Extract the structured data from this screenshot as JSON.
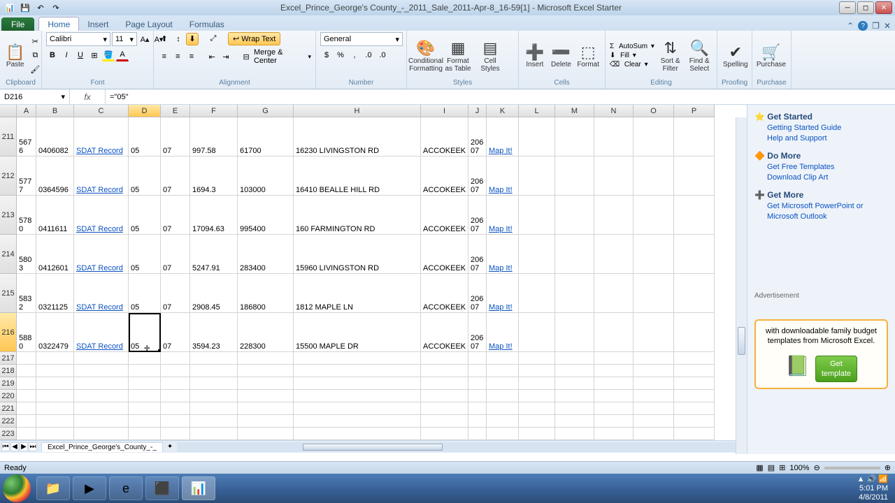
{
  "title": "Excel_Prince_George's County_-_2011_Sale_2011-Apr-8_16-59[1] - Microsoft Excel Starter",
  "ribbon": {
    "file": "File",
    "tabs": [
      "Home",
      "Insert",
      "Page Layout",
      "Formulas"
    ],
    "groups": {
      "clipboard": "Clipboard",
      "font": "Font",
      "alignment": "Alignment",
      "number": "Number",
      "styles": "Styles",
      "cells": "Cells",
      "editing": "Editing",
      "proofing": "Proofing",
      "purchase": "Purchase"
    },
    "paste": "Paste",
    "font_name": "Calibri",
    "font_size": "11",
    "wrap_text": "Wrap Text",
    "merge": "Merge & Center",
    "number_format": "General",
    "cond_format": "Conditional\nFormatting",
    "format_table": "Format\nas Table",
    "cell_styles": "Cell\nStyles",
    "insert": "Insert",
    "delete": "Delete",
    "format": "Format",
    "autosum": "AutoSum",
    "fill": "Fill",
    "clear": "Clear",
    "sort": "Sort &\nFilter",
    "find": "Find &\nSelect",
    "spelling": "Spelling",
    "purchase_btn": "Purchase"
  },
  "namebox": "D216",
  "formula": "=\"05\"",
  "columns": [
    "A",
    "B",
    "C",
    "D",
    "E",
    "F",
    "G",
    "H",
    "I",
    "J",
    "K",
    "L",
    "M",
    "N",
    "O",
    "P"
  ],
  "data_rows": [
    {
      "rn": "211",
      "a": "5676",
      "b": "0406082",
      "c": "SDAT Record",
      "d": "05",
      "e": "07",
      "f": "997.58",
      "g": "61700",
      "h": "16230 LIVINGSTON RD",
      "i": "ACCOKEEK",
      "j": "20607",
      "k": "Map It!"
    },
    {
      "rn": "212",
      "a": "5777",
      "b": "0364596",
      "c": "SDAT Record",
      "d": "05",
      "e": "07",
      "f": "1694.3",
      "g": "103000",
      "h": "16410 BEALLE HILL RD",
      "i": "ACCOKEEK",
      "j": "20607",
      "k": "Map It!"
    },
    {
      "rn": "213",
      "a": "5780",
      "b": "0411611",
      "c": "SDAT Record",
      "d": "05",
      "e": "07",
      "f": "17094.63",
      "g": "995400",
      "h": "160 FARMINGTON RD",
      "i": "ACCOKEEK",
      "j": "20607",
      "k": "Map It!"
    },
    {
      "rn": "214",
      "a": "5803",
      "b": "0412601",
      "c": "SDAT Record",
      "d": "05",
      "e": "07",
      "f": "5247.91",
      "g": "283400",
      "h": "15960 LIVINGSTON RD",
      "i": "ACCOKEEK",
      "j": "20607",
      "k": "Map It!"
    },
    {
      "rn": "215",
      "a": "5832",
      "b": "0321125",
      "c": "SDAT Record",
      "d": "05",
      "e": "07",
      "f": "2908.45",
      "g": "186800",
      "h": "1812 MAPLE LN",
      "i": "ACCOKEEK",
      "j": "20607",
      "k": "Map It!"
    },
    {
      "rn": "216",
      "a": "5880",
      "b": "0322479",
      "c": "SDAT Record",
      "d": "05",
      "e": "07",
      "f": "3594.23",
      "g": "228300",
      "h": "15500 MAPLE DR",
      "i": "ACCOKEEK",
      "j": "20607",
      "k": "Map It!"
    }
  ],
  "empty_rows": [
    "217",
    "218",
    "219",
    "220",
    "221",
    "222",
    "223"
  ],
  "sheet_tab": "Excel_Prince_George's_County_-_",
  "side": {
    "get_started": "Get Started",
    "gs1": "Getting Started Guide",
    "gs2": "Help and Support",
    "do_more": "Do More",
    "dm1": "Get Free Templates",
    "dm2": "Download Clip Art",
    "get_more": "Get More",
    "gm1": "Get Microsoft PowerPoint or Microsoft Outlook",
    "ad_title": "Advertisement",
    "ad_text": "with downloadable family budget templates from Microsoft Excel.",
    "ad_btn": "Get\ntemplate"
  },
  "status": "Ready",
  "zoom": "100%",
  "time": "5:01 PM",
  "date": "4/8/2011"
}
